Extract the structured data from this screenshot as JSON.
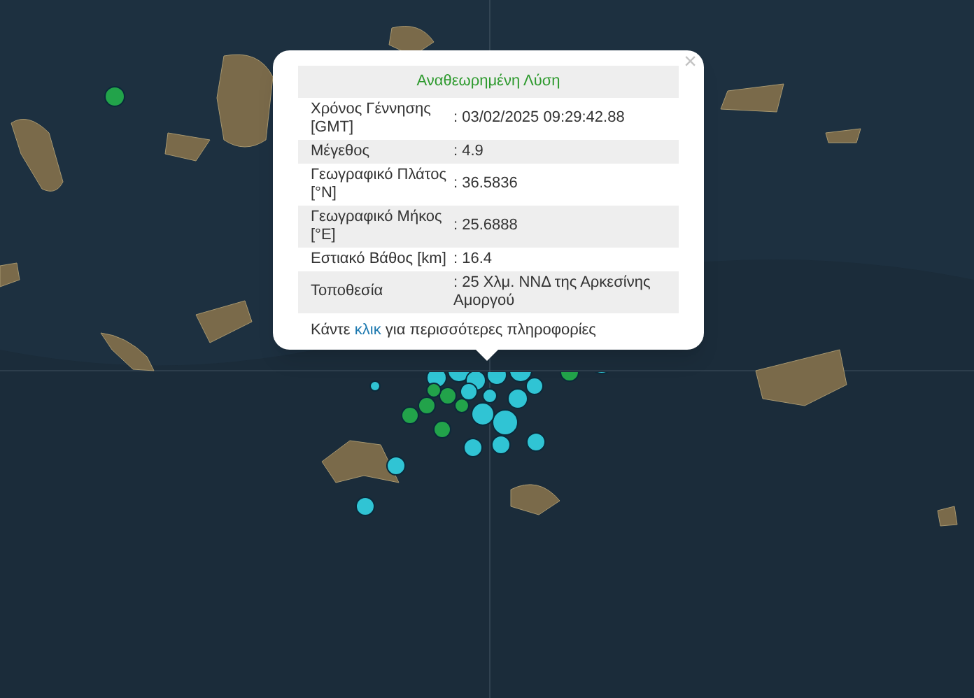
{
  "popup": {
    "close": "×",
    "title": "Αναθεωρημένη Λύση",
    "rows": [
      {
        "label": "Χρόνος Γέννησης [GMT]",
        "value": ": 03/02/2025 09:29:42.88"
      },
      {
        "label": "Μέγεθος",
        "value": ": 4.9"
      },
      {
        "label": "Γεωγραφικό Πλάτος [°N]",
        "value": ": 36.5836"
      },
      {
        "label": "Γεωγραφικό Μήκος [°E]",
        "value": ": 25.6888"
      },
      {
        "label": "Εστιακό Βάθος [km]",
        "value": ": 16.4"
      },
      {
        "label": "Τοποθεσία",
        "value": ": 25 Χλμ. ΝΝΔ της Αρκεσίνης Αμοργού"
      }
    ],
    "footer": {
      "before": "Κάντε",
      "link": "κλικ",
      "after": "για περισσότερες πληροφορίες"
    }
  }
}
